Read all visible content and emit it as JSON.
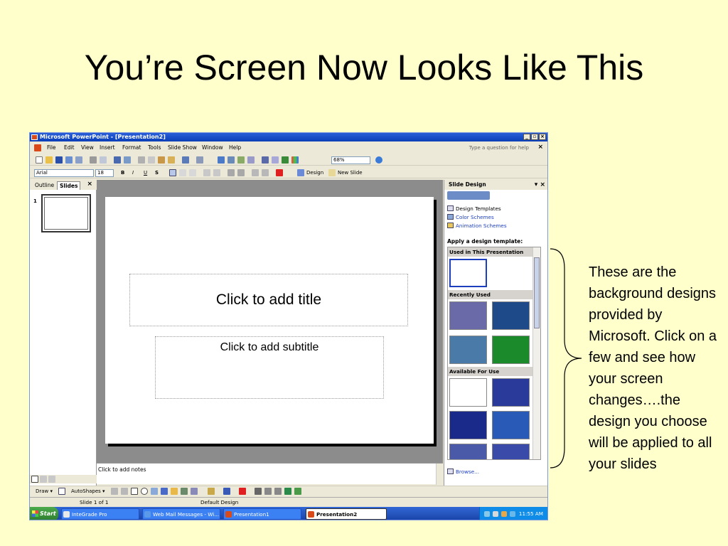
{
  "slide": {
    "title": "You’re Screen Now Looks Like This",
    "annotation": "These are the background designs provided by Microsoft. Click on a few and see how your screen changes….the design you choose will be applied to all your slides"
  },
  "window": {
    "title": "Microsoft PowerPoint - [Presentation2]",
    "controls": [
      "_",
      "▫",
      "×"
    ]
  },
  "menu": {
    "items": [
      "File",
      "Edit",
      "View",
      "Insert",
      "Format",
      "Tools",
      "Slide Show",
      "Window",
      "Help"
    ],
    "help_placeholder": "Type a question for help",
    "close": "×"
  },
  "toolbar": {
    "zoom": "68%",
    "font": "Arial",
    "font_size": "18",
    "bold": "B",
    "italic": "I",
    "underline": "U",
    "shadow": "S",
    "design_label": "Design",
    "new_slide_label": "New Slide"
  },
  "left_pane": {
    "tab_outline": "Outline",
    "tab_slides": "Slides",
    "close": "×",
    "slide_number": "1"
  },
  "editor": {
    "title_placeholder": "Click to add title",
    "subtitle_placeholder": "Click to add subtitle",
    "notes_placeholder": "Click to add notes"
  },
  "task_pane": {
    "title": "Slide Design",
    "close": "▾ ×",
    "links": [
      "Design Templates",
      "Color Schemes",
      "Animation Schemes"
    ],
    "apply_label": "Apply a design template:",
    "sections": [
      "Used in This Presentation",
      "Recently Used",
      "Available For Use"
    ],
    "browse": "Browse..."
  },
  "drawbar": {
    "draw": "Draw ▾",
    "autoshapes": "AutoShapes ▾"
  },
  "status": {
    "slide_of": "Slide 1 of 1",
    "design": "Default Design"
  },
  "taskbar": {
    "start": "Start",
    "buttons": [
      "InteGrade Pro",
      "Web Mail Messages - Wi...",
      "Presentation1",
      "Presentation2"
    ],
    "clock": "11:55 AM"
  },
  "colors": {
    "background": "#FFFFCC",
    "titlebar": "#0A3FB8",
    "link": "#1C3FBF"
  }
}
